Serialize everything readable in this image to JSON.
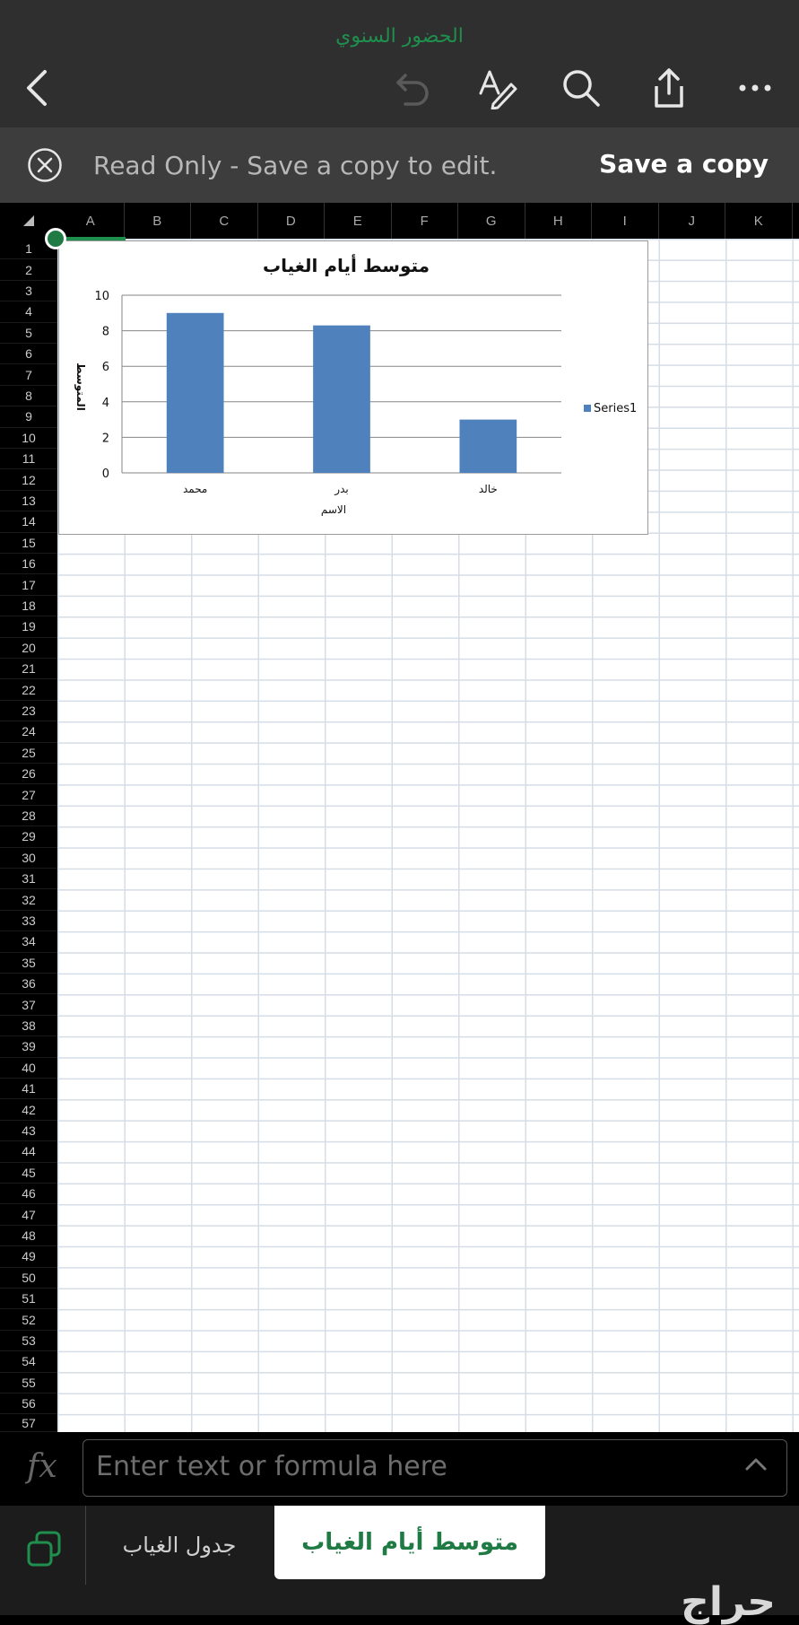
{
  "toolbar": {
    "doc_title": "الحضور السنوي",
    "icons": [
      "chevron-left-icon",
      "undo-icon",
      "draw-text-icon",
      "search-icon",
      "share-icon",
      "more-icon"
    ]
  },
  "banner": {
    "message": "Read Only - Save a copy to edit.",
    "save_label": "Save a copy"
  },
  "columns": [
    "A",
    "B",
    "C",
    "D",
    "E",
    "F",
    "G",
    "H",
    "I",
    "J",
    "K"
  ],
  "chart_data": {
    "type": "bar",
    "title": "متوسط أيام الغياب",
    "xlabel": "الاسم",
    "ylabel": "المتوسط",
    "categories": [
      "محمد",
      "بدر",
      "خالد"
    ],
    "series": [
      {
        "name": "Series1",
        "values": [
          9,
          8.3,
          3
        ]
      }
    ],
    "ylim": [
      0,
      10
    ],
    "yticks": [
      "0",
      "2",
      "4",
      "6",
      "8",
      "10"
    ],
    "grid": true,
    "legend": "right",
    "color": "#4f81bd"
  },
  "formula_bar": {
    "placeholder": "Enter text or formula here"
  },
  "sheets": [
    {
      "label": "جدول الغياب",
      "active": false
    },
    {
      "label": "متوسط أيام الغياب",
      "active": true
    }
  ],
  "watermark": "حراج",
  "colors": {
    "accent": "#1f8f4e",
    "bar": "#4f81bd"
  }
}
